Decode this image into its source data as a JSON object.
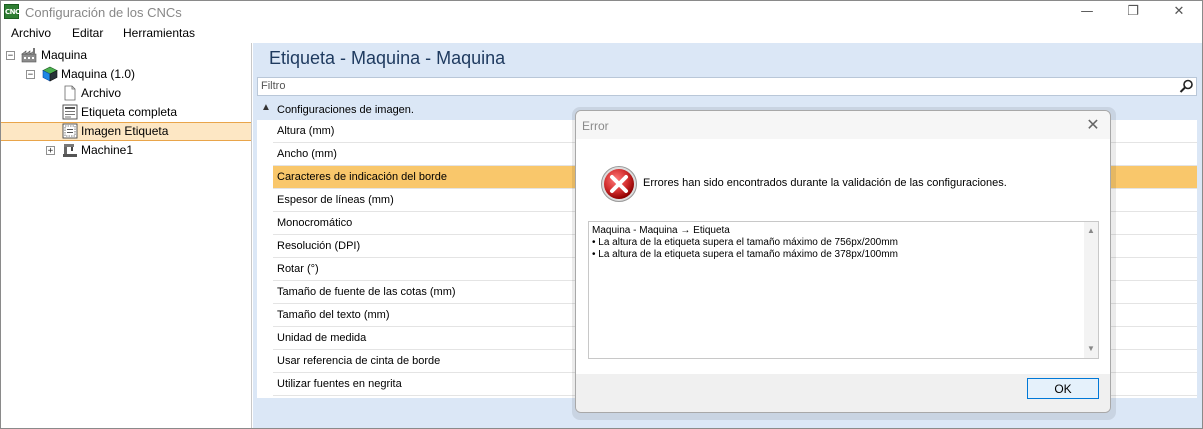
{
  "window": {
    "title": "Configuración de los CNCs",
    "app_icon_text": "CNC",
    "controls": {
      "minimize": "—",
      "maximize": "❐",
      "close": "✕"
    }
  },
  "menubar": {
    "items": [
      {
        "label": "Archivo"
      },
      {
        "label": "Editar"
      },
      {
        "label": "Herramientas"
      }
    ]
  },
  "tree": {
    "items": [
      {
        "label": "Maquina",
        "expander": "−",
        "icon": "factory-icon"
      },
      {
        "label": "Maquina (1.0)",
        "expander": "−",
        "icon": "cube-icon"
      },
      {
        "label": "Archivo",
        "icon": "document-icon"
      },
      {
        "label": "Etiqueta completa",
        "icon": "label-icon"
      },
      {
        "label": "Imagen Etiqueta",
        "icon": "label-image-icon",
        "selected": true
      },
      {
        "label": "Machine1",
        "expander": "+",
        "icon": "cnc-machine-icon"
      }
    ]
  },
  "main": {
    "title": "Etiqueta - Maquina - Maquina",
    "filter_placeholder": "Filtro",
    "group_label": "Configuraciones de imagen.",
    "properties": [
      {
        "label": "Altura (mm)"
      },
      {
        "label": "Ancho (mm)"
      },
      {
        "label": "Caracteres de indicación del borde",
        "selected": true
      },
      {
        "label": "Espesor de líneas (mm)"
      },
      {
        "label": "Monocromático"
      },
      {
        "label": "Resolución (DPI)"
      },
      {
        "label": "Rotar (°)"
      },
      {
        "label": "Tamaño de fuente de las cotas (mm)"
      },
      {
        "label": "Tamaño del texto (mm)"
      },
      {
        "label": "Unidad de medida"
      },
      {
        "label": "Usar referencia de cinta de borde"
      },
      {
        "label": "Utilizar fuentes en negrita"
      }
    ]
  },
  "dialog": {
    "title": "Error",
    "close": "✕",
    "message": "Errores han sido encontrados durante la validación de las configuraciones.",
    "details": [
      "Maquina - Maquina → Etiqueta",
      "• La altura de la etiqueta supera el tamaño máximo de 756px/200mm",
      "• La altura de la etiqueta supera el tamaño máximo de 378px/100mm"
    ],
    "ok_label": "OK"
  },
  "colors": {
    "selection": "#f9c76b",
    "tree_selection": "#fde7c4",
    "panel_bg": "#dbe7f6",
    "accent": "#0078d7",
    "error_red": "#d32f2f"
  }
}
